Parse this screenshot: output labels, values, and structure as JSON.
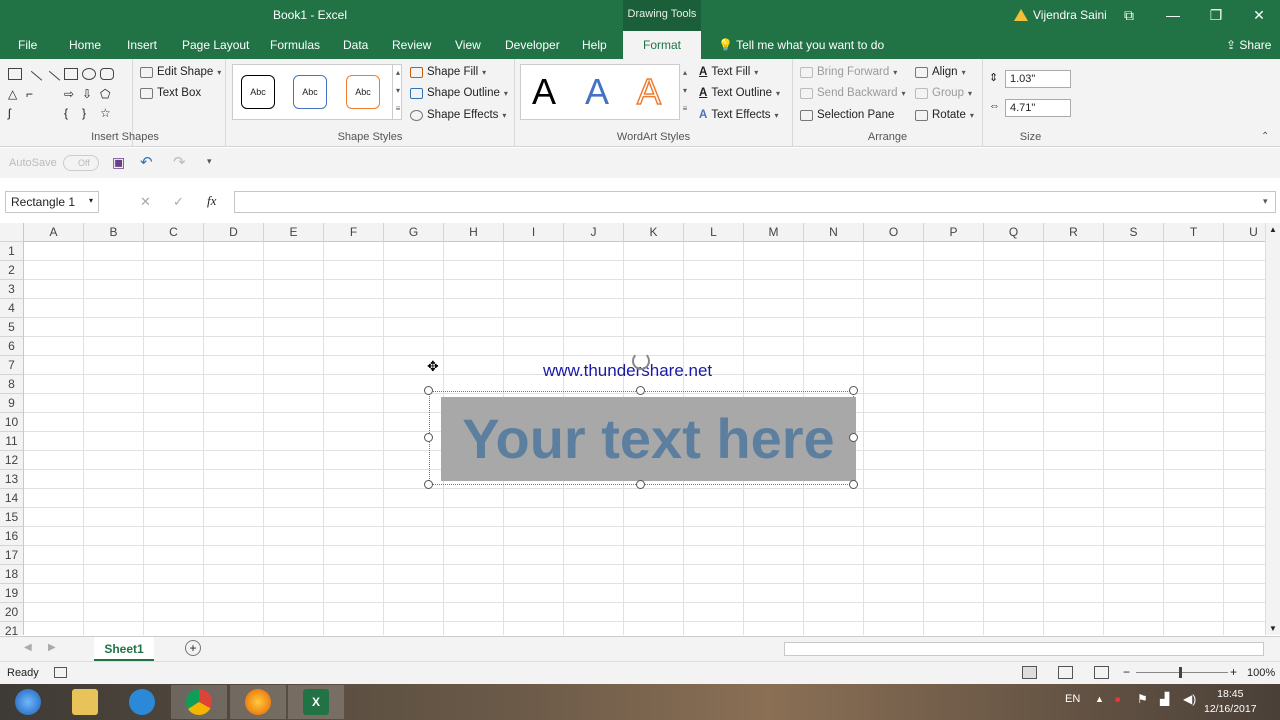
{
  "window": {
    "title": "Book1  -  Excel",
    "context_tab_group": "Drawing Tools",
    "user": "Vijendra Saini",
    "share": "Share",
    "controls": [
      "⧉",
      "—",
      "❐",
      "✕"
    ]
  },
  "tabs": [
    "File",
    "Home",
    "Insert",
    "Page Layout",
    "Formulas",
    "Data",
    "Review",
    "View",
    "Developer",
    "Help"
  ],
  "active_tab": "Format",
  "tell_me": "Tell me what you want to do",
  "ribbon": {
    "insert_shapes": {
      "label": "Insert Shapes",
      "edit_shape": "Edit Shape",
      "text_box": "Text Box"
    },
    "shape_styles": {
      "label": "Shape Styles",
      "sample": "Abc",
      "shape_fill": "Shape Fill",
      "shape_outline": "Shape Outline",
      "shape_effects": "Shape Effects"
    },
    "wordart_styles": {
      "label": "WordArt Styles",
      "letter": "A",
      "text_fill": "Text Fill",
      "text_outline": "Text Outline",
      "text_effects": "Text Effects"
    },
    "arrange": {
      "label": "Arrange",
      "bring_forward": "Bring Forward",
      "send_backward": "Send Backward",
      "selection_pane": "Selection Pane",
      "align": "Align",
      "group": "Group",
      "rotate": "Rotate"
    },
    "size": {
      "label": "Size",
      "height": "1.03\"",
      "width": "4.71\""
    }
  },
  "qat": {
    "autosave": "AutoSave",
    "autosave_state": "Off"
  },
  "formula_bar": {
    "name_box": "Rectangle 1",
    "fx": "fx",
    "value": ""
  },
  "columns": [
    "A",
    "B",
    "C",
    "D",
    "E",
    "F",
    "G",
    "H",
    "I",
    "J",
    "K",
    "L",
    "M",
    "N",
    "O",
    "P",
    "Q",
    "R",
    "S",
    "T",
    "U"
  ],
  "rows": [
    "1",
    "2",
    "3",
    "4",
    "5",
    "6",
    "7",
    "8",
    "9",
    "10",
    "11",
    "12",
    "13",
    "14",
    "15",
    "16",
    "17",
    "18",
    "19",
    "20",
    "21"
  ],
  "canvas": {
    "url": "www.thundershare.net",
    "wordart": "Your text here"
  },
  "sheet_tab": "Sheet1",
  "status": {
    "ready": "Ready",
    "zoom": "100%"
  },
  "taskbar": {
    "lang": "EN",
    "time": "18:45",
    "date": "12/16/2017"
  },
  "colors": {
    "excel_green": "#217346",
    "wordart_text": "#5d7f9f",
    "url_text": "#1a1aa6"
  }
}
